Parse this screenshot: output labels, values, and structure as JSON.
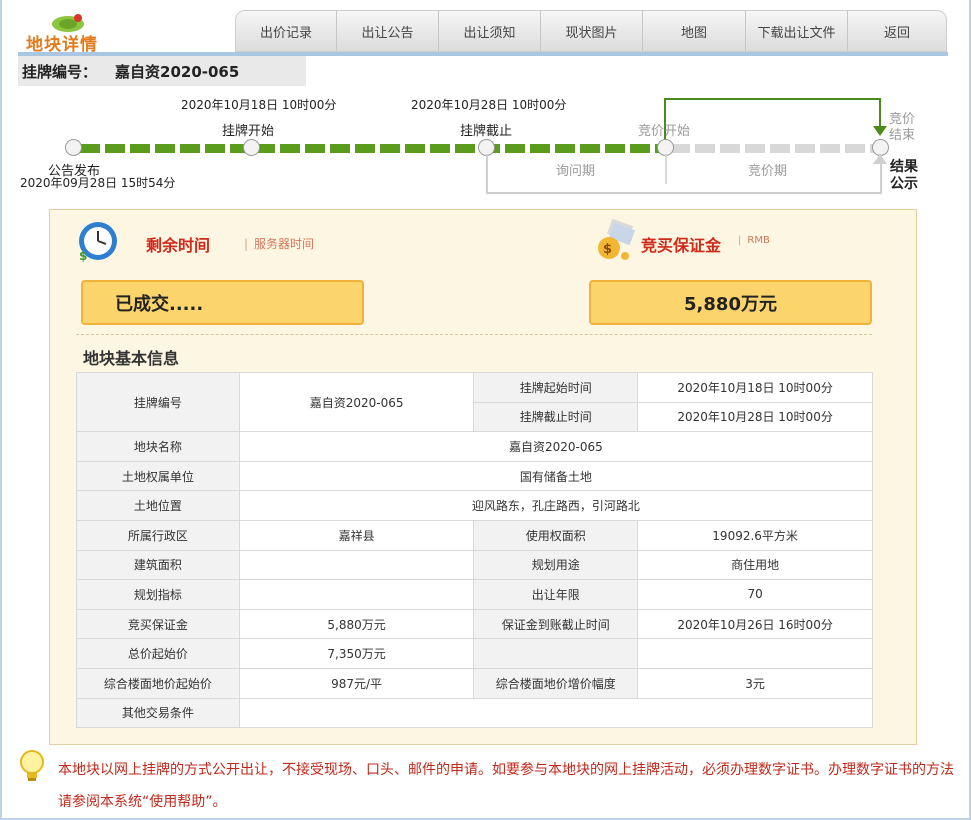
{
  "header": {
    "logo_text": "地块详情",
    "tabs": [
      {
        "label": "出价记录"
      },
      {
        "label": "出让公告"
      },
      {
        "label": "出让须知"
      },
      {
        "label": "现状图片"
      },
      {
        "label": "地图"
      },
      {
        "label": "下载出让文件"
      },
      {
        "label": "返回"
      }
    ]
  },
  "listing": {
    "label": "挂牌编号：",
    "value": "嘉自资2020-065"
  },
  "timeline": {
    "start_datetime": "2020年10月18日 10时00分",
    "end_datetime": "2020年10月28日 10时00分",
    "notice_label": "公告发布",
    "notice_datetime": "2020年09月28日 15时54分",
    "listing_start": "挂牌开始",
    "listing_end": "挂牌截止",
    "bidding_start": "竞价开始",
    "bidding_end_1": "竞价",
    "bidding_end_2": "结束",
    "result_1": "结果",
    "result_2": "公示",
    "inquiry_period": "询问期",
    "bidding_period": "竞价期"
  },
  "panel": {
    "remaining_title": "剩余时间",
    "server_time": "服务器时间",
    "deposit_title": "竞买保证金",
    "currency": "RMB",
    "status": "已成交.....",
    "deposit_value": "5,880万元",
    "basic_info_title": "地块基本信息"
  },
  "table": {
    "r1": {
      "k1": "挂牌编号",
      "v1": "嘉自资2020-065",
      "k2": "挂牌起始时间",
      "v2": "2020年10月18日 10时00分"
    },
    "r2": {
      "k2": "挂牌截止时间",
      "v2": "2020年10月28日 10时00分"
    },
    "r3": {
      "k1": "地块名称",
      "v1": "嘉自资2020-065"
    },
    "r4": {
      "k1": "土地权属单位",
      "v1": "国有储备土地"
    },
    "r5": {
      "k1": "土地位置",
      "v1": "迎风路东，孔庄路西，引河路北"
    },
    "r6": {
      "k1": "所属行政区",
      "v1": "嘉祥县",
      "k2": "使用权面积",
      "v2": "19092.6平方米"
    },
    "r7": {
      "k1": "建筑面积",
      "v1": "",
      "k2": "规划用途",
      "v2": "商住用地"
    },
    "r8": {
      "k1": "规划指标",
      "v1": "",
      "k2": "出让年限",
      "v2": "70"
    },
    "r9": {
      "k1": "竞买保证金",
      "v1": "5,880万元",
      "k2": "保证金到账截止时间",
      "v2": "2020年10月26日 16时00分"
    },
    "r10": {
      "k1": "总价起始价",
      "v1": "7,350万元",
      "k2": "",
      "v2": ""
    },
    "r11": {
      "k1": "综合楼面地价起始价",
      "v1": "987元/平",
      "k2": "综合楼面地价增价幅度",
      "v2": "3元"
    },
    "r12": {
      "k1": "其他交易条件",
      "v1": ""
    }
  },
  "notice": {
    "text": "本地块以网上挂牌的方式公开出让，不接受现场、口头、邮件的申请。如要参与本地块的网上挂牌活动，必须办理数字证书。办理数字证书的方法请参阅本系统“使用帮助”。"
  },
  "colors": {
    "accent_red": "#d02a1a",
    "progress_green": "#5b9c1c",
    "box_yellow": "#fbd46b",
    "logo_orange": "#e37b1c"
  }
}
